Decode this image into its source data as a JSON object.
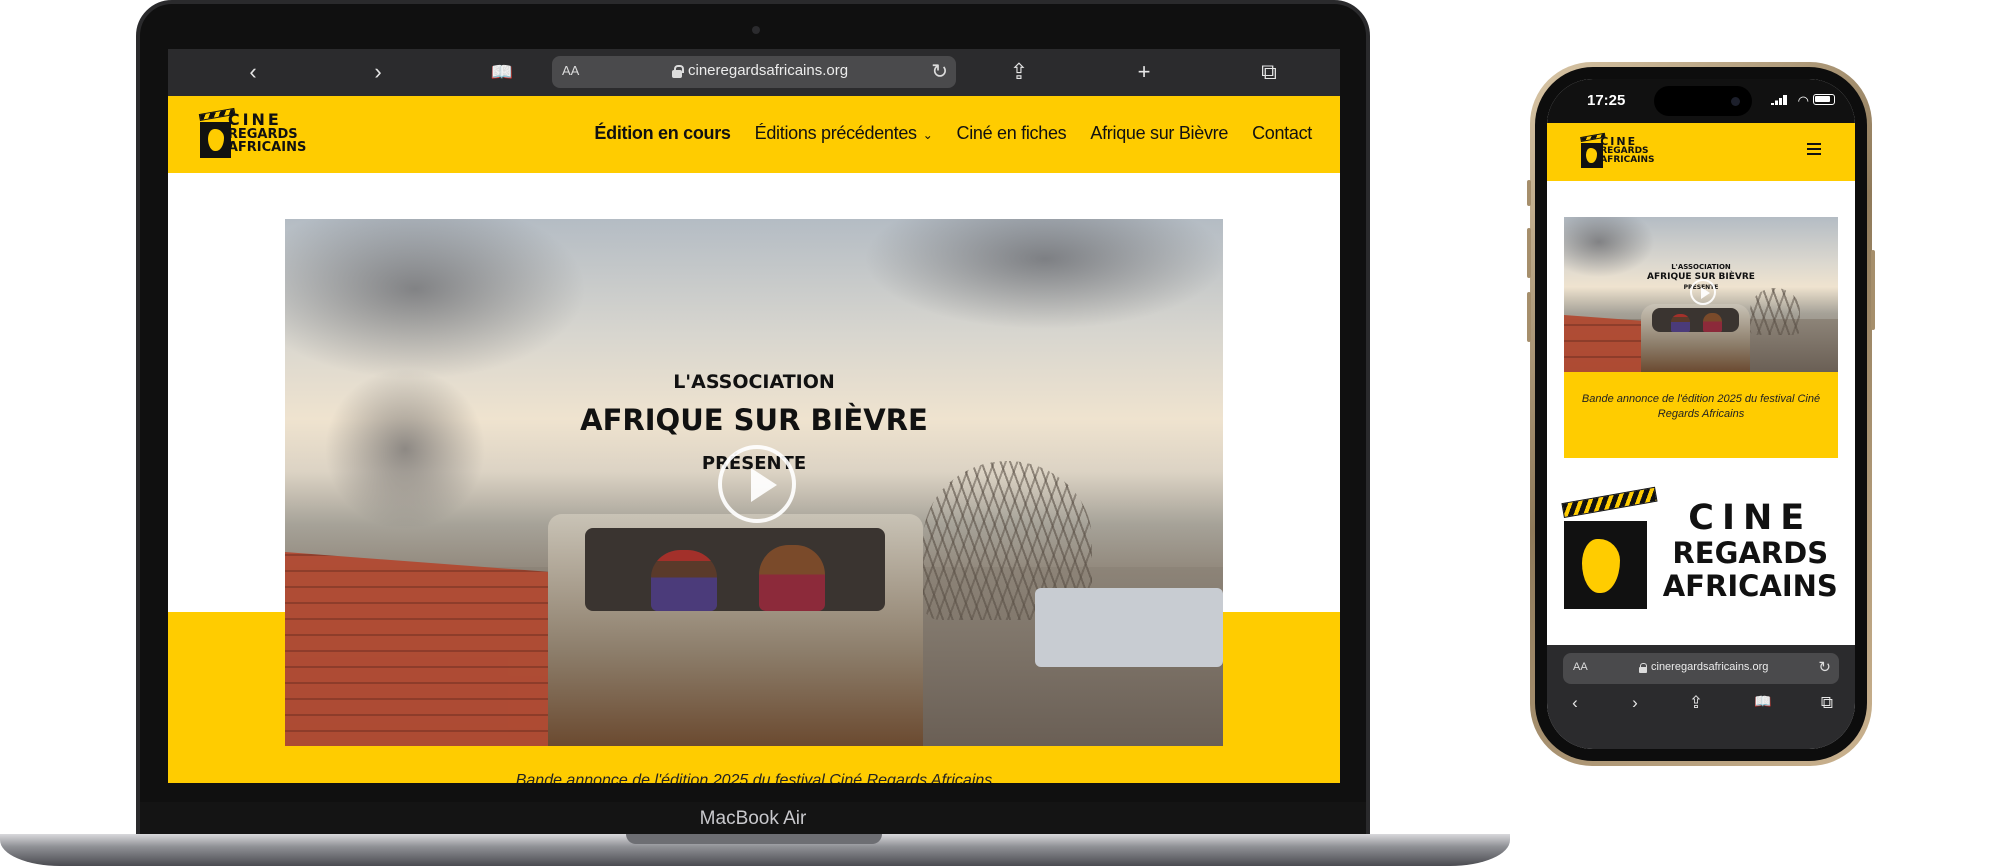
{
  "desktop": {
    "browser": {
      "url_aa": "AA",
      "domain": "cineregardsafricains.org",
      "icons": [
        "back-icon",
        "forward-icon",
        "bookmarks-icon",
        "reload-icon",
        "share-icon",
        "new-tab-icon",
        "tabs-icon"
      ]
    },
    "logo": {
      "line1": "CINE",
      "line2": "REGARDS",
      "line3": "AFRICAINS"
    },
    "nav": {
      "items": [
        {
          "label": "Édition en cours",
          "active": true
        },
        {
          "label": "Éditions précédentes",
          "dropdown": true
        },
        {
          "label": "Ciné en fiches"
        },
        {
          "label": "Afrique sur Bièvre"
        },
        {
          "label": "Contact"
        }
      ]
    },
    "hero": {
      "line1": "L'ASSOCIATION",
      "line2": "AFRIQUE SUR BIÈVRE",
      "line3": "PRÉSENTE",
      "caption": "Bande annonce de l'édition 2025 du festival Ciné Regards Africains"
    },
    "device_label": "MacBook Air"
  },
  "mobile": {
    "status": {
      "time": "17:25"
    },
    "logo": {
      "line1": "CINE",
      "line2": "REGARDS",
      "line3": "AFRICAINS"
    },
    "video": {
      "line1": "L'ASSOCIATION",
      "line2": "AFRIQUE SUR BIÈVRE",
      "line3": "PRÉSENTE"
    },
    "caption": "Bande annonce de l'édition 2025 du festival Ciné Regards Africains",
    "big_logo": {
      "line1": "CINE",
      "line2": "REGARDS",
      "line3": "AFRICAINS"
    },
    "browser": {
      "url_aa": "AA",
      "domain": "cineregardsafricains.org"
    }
  },
  "colors": {
    "brand_yellow": "#ffcc00",
    "text_dark": "#111111",
    "browser_chrome": "#2b2b2d"
  }
}
